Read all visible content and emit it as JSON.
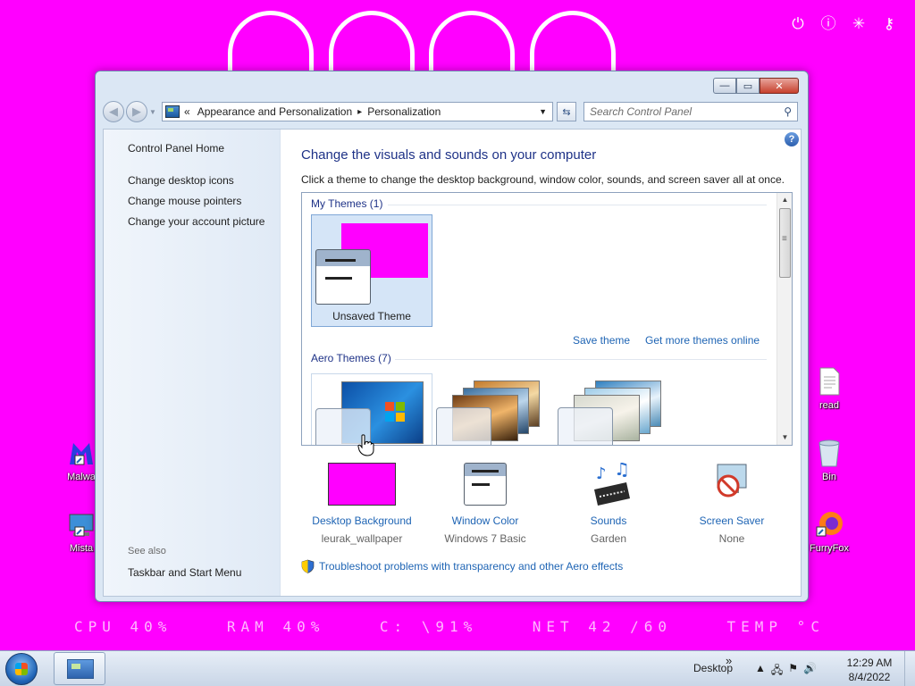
{
  "top_icons": [
    "power-icon",
    "info-icon",
    "loading-icon",
    "key-icon"
  ],
  "stats": {
    "cpu": "CPU 40%",
    "ram": "RAM 40%",
    "disk": "C: \\91%",
    "net": "NET 42 /60",
    "temp": "TEMP °C"
  },
  "desktop_icons": {
    "malwarebytes": "Malwa",
    "mista": "Mista",
    "read": "read",
    "bin": "Bin",
    "furryfox": "FurryFox"
  },
  "window": {
    "address": {
      "chevrons": "«",
      "crumb1": "Appearance and Personalization",
      "sep": "▸",
      "crumb2": "Personalization"
    },
    "search_placeholder": "Search Control Panel",
    "sidebar": {
      "home": "Control Panel Home",
      "link1": "Change desktop icons",
      "link2": "Change mouse pointers",
      "link3": "Change your account picture",
      "see_also": "See also",
      "taskbar_link": "Taskbar and Start Menu"
    },
    "heading": "Change the visuals and sounds on your computer",
    "subheading": "Click a theme to change the desktop background, window color, sounds, and screen saver all at once.",
    "my_themes_title": "My Themes (1)",
    "unsaved_theme": "Unsaved Theme",
    "save_theme": "Save theme",
    "get_more": "Get more themes online",
    "aero_themes_title": "Aero Themes (7)",
    "options": [
      {
        "label": "Desktop Background",
        "value": "leurak_wallpaper"
      },
      {
        "label": "Window Color",
        "value": "Windows 7 Basic"
      },
      {
        "label": "Sounds",
        "value": "Garden"
      },
      {
        "label": "Screen Saver",
        "value": "None"
      }
    ],
    "troubleshoot": "Troubleshoot problems with transparency and other Aero effects"
  },
  "taskbar": {
    "desktop": "Desktop",
    "chevron": "»",
    "time": "12:29 AM",
    "date": "8/4/2022"
  },
  "colors": {
    "desktop": "#ff00ff",
    "link": "#1e64b4",
    "heading": "#1e3287"
  }
}
